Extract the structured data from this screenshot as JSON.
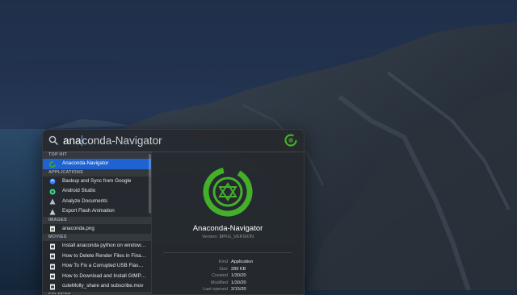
{
  "search": {
    "typed": "ana",
    "completion": "conda-Navigator"
  },
  "sections": [
    {
      "header": "TOP HIT",
      "items": [
        {
          "label": "Anaconda-Navigator",
          "icon": "anaconda-icon",
          "selected": true
        }
      ]
    },
    {
      "header": "APPLICATIONS",
      "items": [
        {
          "label": "Backup and Sync from Google",
          "icon": "backup-sync-icon"
        },
        {
          "label": "Android Studio",
          "icon": "android-studio-icon"
        },
        {
          "label": "Analyze Documents",
          "icon": "analyze-documents-icon"
        },
        {
          "label": "Export Flash Animation",
          "icon": "export-flash-icon"
        }
      ]
    },
    {
      "header": "IMAGES",
      "items": [
        {
          "label": "anaconda.png",
          "icon": "image-file-icon"
        }
      ]
    },
    {
      "header": "MOVIES",
      "items": [
        {
          "label": "install anaconda python on windows...",
          "icon": "movie-file-icon"
        },
        {
          "label": "How to Delete Render Files in Final...",
          "icon": "movie-file-icon"
        },
        {
          "label": "How To Fix a Corrupted USB Flash D...",
          "icon": "movie-file-icon"
        },
        {
          "label": "How to Download and Install GIMP o...",
          "icon": "movie-file-icon"
        },
        {
          "label": "cuteMolly_share and subscribe.mov",
          "icon": "movie-file-icon"
        }
      ]
    },
    {
      "header": "FOLDERS",
      "items": []
    }
  ],
  "preview": {
    "title": "Anaconda-Navigator",
    "version": "Version: $PKG_VERSION",
    "meta": [
      {
        "key": "Kind",
        "value": "Application"
      },
      {
        "key": "Size",
        "value": "289 KB"
      },
      {
        "key": "Created",
        "value": "1/30/20"
      },
      {
        "key": "Modified",
        "value": "1/30/20"
      },
      {
        "key": "Last opened",
        "value": "2/15/20"
      }
    ]
  },
  "colors": {
    "selection": "#1f63d2",
    "anaconda_green": "#43b02a",
    "panel": "#26292e"
  }
}
